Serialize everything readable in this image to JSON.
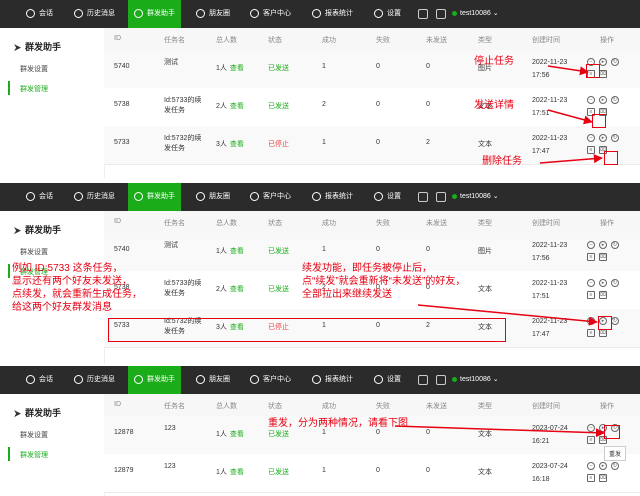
{
  "nav": {
    "items": [
      "会话",
      "历史消息",
      "群发助手",
      "朋友圈",
      "客户中心",
      "报表统计",
      "设置"
    ],
    "username": "test10086"
  },
  "sidebar": {
    "title": "群发助手",
    "items": [
      "群发设置",
      "群发管理"
    ]
  },
  "table": {
    "headers": [
      "ID",
      "任务名",
      "总人数",
      "状态",
      "成功",
      "失败",
      "未发送",
      "类型",
      "创建时间",
      "操作"
    ]
  },
  "panels": [
    {
      "rows": [
        {
          "id": "5740",
          "name": "测试",
          "total": "1人",
          "view": "查看",
          "status": "已发送",
          "status_color": "green",
          "success": "1",
          "fail": "0",
          "unsent": "0",
          "type": "图片",
          "created": "2022-11-23 17:56"
        },
        {
          "id": "5738",
          "name": "Id:5733的续发任务",
          "total": "2人",
          "view": "查看",
          "status": "已发送",
          "status_color": "green",
          "success": "2",
          "fail": "0",
          "unsent": "0",
          "type": "文本",
          "created": "2022-11-23 17:51"
        },
        {
          "id": "5733",
          "name": "Id:5732的续发任务",
          "total": "3人",
          "view": "查看",
          "status": "已停止",
          "status_color": "red",
          "success": "1",
          "fail": "0",
          "unsent": "2",
          "type": "文本",
          "created": "2022-11-23 17:47"
        }
      ],
      "annotations": [
        "停止任务",
        "发送详情",
        "删除任务"
      ]
    },
    {
      "rows": [
        {
          "id": "5740",
          "name": "测试",
          "total": "1人",
          "view": "查看",
          "status": "已发送",
          "status_color": "green",
          "success": "1",
          "fail": "0",
          "unsent": "0",
          "type": "图片",
          "created": "2022-11-23 17:56"
        },
        {
          "id": "5738",
          "name": "Id:5733的续发任务",
          "total": "2人",
          "view": "查看",
          "status": "已发送",
          "status_color": "green",
          "success": "2",
          "fail": "0",
          "unsent": "0",
          "type": "文本",
          "created": "2022-11-23 17:51"
        },
        {
          "id": "5733",
          "name": "Id:5732的续发任务",
          "total": "3人",
          "view": "查看",
          "status": "已停止",
          "status_color": "red",
          "success": "1",
          "fail": "0",
          "unsent": "2",
          "type": "文本",
          "created": "2022-11-23 17:47"
        }
      ],
      "annotations": [
        "例如 ID:5733 这条任务，\n显示还有两个好友未发送，\n点续发，就会重新生成任务，\n给这两个好友群发消息",
        "续发功能，即任务被停止后，\n点“续发”就会重新将“未发送”的好友，\n全部拉出来继续发送"
      ]
    },
    {
      "rows": [
        {
          "id": "12878",
          "name": "123",
          "total": "1人",
          "view": "查看",
          "status": "已发送",
          "status_color": "green",
          "success": "1",
          "fail": "0",
          "unsent": "0",
          "type": "文本",
          "created": "2023-07-24 16:21"
        },
        {
          "id": "12879",
          "name": "123",
          "total": "1人",
          "view": "查看",
          "status": "已发送",
          "status_color": "green",
          "success": "1",
          "fail": "0",
          "unsent": "0",
          "type": "文本",
          "created": "2023-07-24 16:18"
        }
      ],
      "annotations": [
        "重发，分为两种情况，请看下图"
      ],
      "tooltip": "重发"
    }
  ]
}
